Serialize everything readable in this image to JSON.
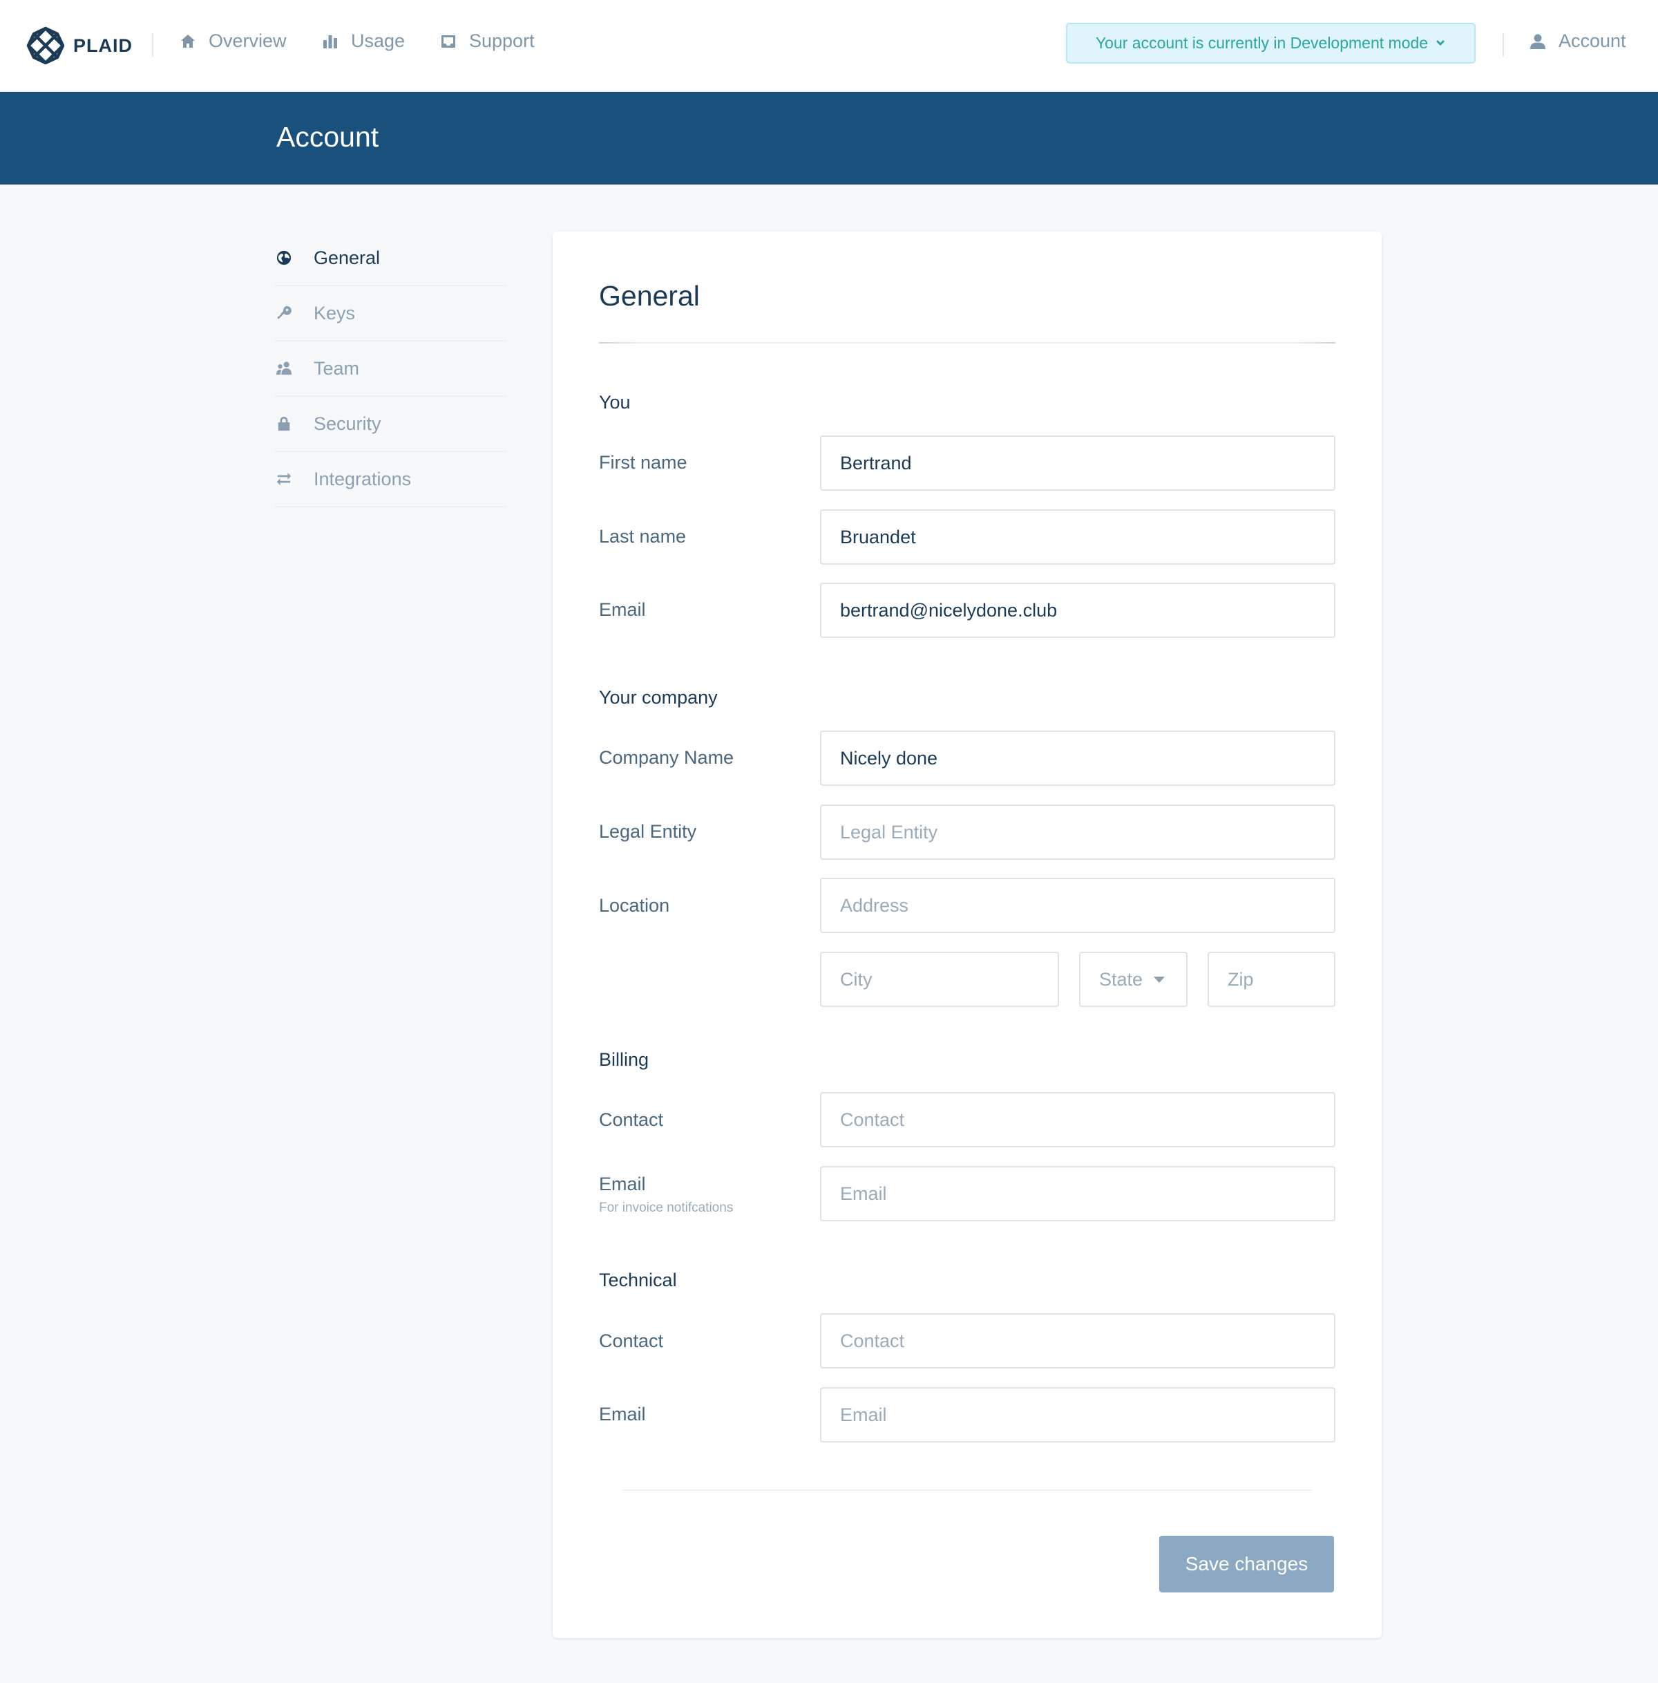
{
  "nav": {
    "logo_text": "PLAID",
    "items": [
      {
        "label": "Overview",
        "icon": "home-icon"
      },
      {
        "label": "Usage",
        "icon": "bar-chart-icon"
      },
      {
        "label": "Support",
        "icon": "inbox-icon"
      }
    ],
    "dev_banner": "Your account is currently in Development mode",
    "account_label": "Account"
  },
  "header": {
    "title": "Account"
  },
  "sidebar": {
    "items": [
      {
        "label": "General",
        "icon": "globe-icon",
        "active": true
      },
      {
        "label": "Keys",
        "icon": "key-icon",
        "active": false
      },
      {
        "label": "Team",
        "icon": "team-icon",
        "active": false
      },
      {
        "label": "Security",
        "icon": "lock-icon",
        "active": false
      },
      {
        "label": "Integrations",
        "icon": "swap-icon",
        "active": false
      }
    ]
  },
  "form": {
    "title": "General",
    "you": {
      "section": "You",
      "first_name": {
        "label": "First name",
        "value": "Bertrand"
      },
      "last_name": {
        "label": "Last name",
        "value": "Bruandet"
      },
      "email": {
        "label": "Email",
        "value": "bertrand@nicelydone.club"
      }
    },
    "company": {
      "section": "Your company",
      "name": {
        "label": "Company Name",
        "value": "Nicely done"
      },
      "legal_entity": {
        "label": "Legal Entity",
        "value": "",
        "placeholder": "Legal Entity"
      },
      "location": {
        "label": "Location",
        "address_placeholder": "Address",
        "city_placeholder": "City",
        "state_placeholder": "State",
        "zip_placeholder": "Zip"
      }
    },
    "billing": {
      "section": "Billing",
      "contact": {
        "label": "Contact",
        "placeholder": "Contact"
      },
      "email": {
        "label": "Email",
        "sublabel": "For invoice notifcations",
        "placeholder": "Email"
      }
    },
    "technical": {
      "section": "Technical",
      "contact": {
        "label": "Contact",
        "placeholder": "Contact"
      },
      "email": {
        "label": "Email",
        "placeholder": "Email"
      }
    },
    "save_label": "Save changes"
  },
  "colors": {
    "brand_dark": "#1a517c",
    "text_primary": "#1b3a57",
    "text_muted": "#8ba0b2",
    "banner_bg": "#dff4fb",
    "banner_text": "#2aa6a1",
    "button_bg": "#8ba9c2"
  }
}
